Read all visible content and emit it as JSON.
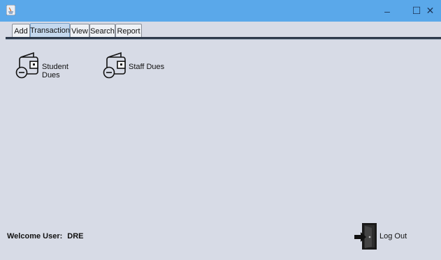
{
  "window": {
    "minimize_glyph": "–",
    "maximize_glyph": "☐",
    "close_glyph": "✕"
  },
  "tabs": [
    {
      "label": "Add"
    },
    {
      "label": "Transaction"
    },
    {
      "label": "View"
    },
    {
      "label": "Search"
    },
    {
      "label": "Report"
    }
  ],
  "active_tab": "Transaction",
  "tools": [
    {
      "label": "Student Dues",
      "icon": "wallet-icon"
    },
    {
      "label": "Staff Dues",
      "icon": "wallet-icon"
    }
  ],
  "status": {
    "welcome_label": "Welcome User:",
    "user_name": "DRE"
  },
  "logout": {
    "label": "Log Out",
    "icon": "logout-door-icon"
  },
  "colors": {
    "titlebar": "#5aa8ea",
    "background": "#d7dbe6",
    "active_tab": "#c4d8ee"
  }
}
